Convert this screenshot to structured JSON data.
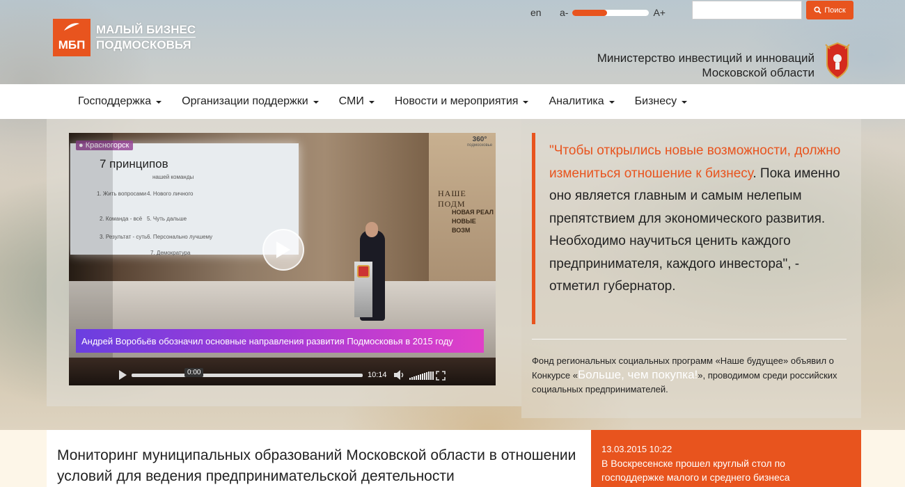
{
  "header": {
    "logo": {
      "mark": "МБП",
      "line1": "МАЛЫЙ БИЗНЕС",
      "line2": "ПОДМОСКОВЬЯ"
    },
    "lang": "en",
    "font_size": {
      "decrease": "a-",
      "increase": "A+",
      "level": 0.45
    },
    "search": {
      "placeholder": "",
      "button_label": "Поиск"
    },
    "ministry": {
      "line1": "Министерство инвестиций и инноваций",
      "line2": "Московской области"
    }
  },
  "nav": {
    "items": [
      {
        "label": "Господдержка"
      },
      {
        "label": "Организации поддержки"
      },
      {
        "label": "СМИ"
      },
      {
        "label": "Новости и мероприятия"
      },
      {
        "label": "Аналитика"
      },
      {
        "label": "Бизнесу"
      }
    ]
  },
  "video": {
    "location_label": "Красногорск",
    "channel_logo": "360°",
    "channel_sub": "подмосковье",
    "screen_title": "7 принципов",
    "screen_subtitle": "нашей команды",
    "screen_items": [
      "1. Жить вопросами",
      "2. Команда - всё",
      "3. Результат - суть",
      "4. Нового личного",
      "5. Чуть дальше",
      "6. Персонально лучшему",
      "7. Демократура"
    ],
    "backdrop_title": "НАШЕ ПОДМ",
    "backdrop_sub1": "НОВАЯ РЕАЛ",
    "backdrop_sub2": "НОВЫЕ ВОЗМ",
    "caption": "Андрей Воробьёв обозначил основные направления развития Подмосковья в 2015 году",
    "current_time": "0:00",
    "duration": "10:14",
    "progress": 0.0
  },
  "quote": {
    "highlight": "\"Чтобы открылись новые возможности, должно измениться отношение к бизнесу",
    "rest": ". Пока именно оно является главным и самым нелепым препятствием для экономического развития. Необходимо научиться ценить каждого предпринимателя, каждого инвестора\", - отметил губернатор."
  },
  "fund": {
    "before": "Фонд региональных социальных программ «Наше будущее» объявил о Конкурсе «",
    "highlight": "Больше, чем покупка!",
    "after": "», проводимом среди российских социальных предпринимателей."
  },
  "news": {
    "main_title": "Мониторинг муниципальных образований Московской области в отношении условий для ведения предпринимательской деятельности",
    "side_date": "13.03.2015 10:22",
    "side_text": "В Воскресенске прошел круглый стол по господдержке малого и среднего бизнеса"
  },
  "colors": {
    "accent": "#e8541e"
  }
}
